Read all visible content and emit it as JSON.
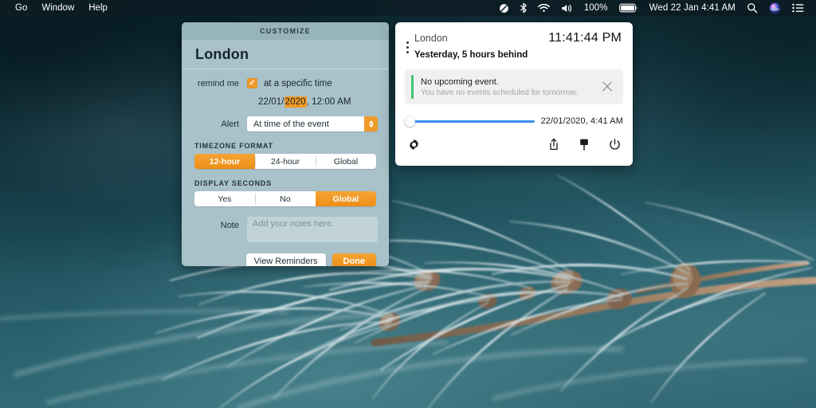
{
  "menubar": {
    "left_items": [
      "Go",
      "Window",
      "Help"
    ],
    "status_icons": [
      "do-not-disturb-icon",
      "bluetooth-icon",
      "wifi-icon",
      "volume-icon"
    ],
    "battery_percent": "100%",
    "battery_icon": "battery-icon",
    "datetime": "Wed 22 Jan  4:41 AM",
    "right_icons": [
      "search-icon",
      "siri-icon",
      "control-center-icon"
    ]
  },
  "customize": {
    "header_title": "CUSTOMIZE",
    "city": "London",
    "remind_label": "remind me",
    "remind_checked": true,
    "remind_text": "at a specific time",
    "date_prefix": "22/01/",
    "date_highlight": "2020",
    "date_suffix": ", 12:00 AM",
    "alert_label": "Alert",
    "alert_value": "At time of the event",
    "timezone_section": "TIMEZONE FORMAT",
    "timezone_options": [
      "12-hour",
      "24-hour",
      "Global"
    ],
    "timezone_selected": "12-hour",
    "seconds_section": "DISPLAY SECONDS",
    "seconds_options": [
      "Yes",
      "No",
      "Global"
    ],
    "seconds_selected": "Global",
    "note_label": "Note",
    "note_value": "",
    "note_placeholder": "Add your notes here.",
    "view_reminders_label": "View Reminders",
    "done_label": "Done"
  },
  "clock_panel": {
    "city": "London",
    "time": "11:41:44 PM",
    "offset_text": "Yesterday, 5 hours behind",
    "event": {
      "title": "No upcoming event.",
      "subtitle": "You have no events scheduled for tomorrow.",
      "accent_color": "#3ec46d",
      "close_icon": "close-icon"
    },
    "slider": {
      "value_label": "22/01/2020,  4:41 AM",
      "position_percent": 0,
      "track_color": "#3d8bf0"
    },
    "toolbar": {
      "settings_icon": "gear-icon",
      "share_icon": "share-icon",
      "pin_icon": "pin-icon",
      "power_icon": "power-icon"
    }
  },
  "colors": {
    "accent_orange": "#f09a28",
    "panel_bg": "#a9c2c9",
    "panel_header_bg": "#97b3bb",
    "slider_blue": "#3d8bf0",
    "event_green": "#3ec46d"
  }
}
